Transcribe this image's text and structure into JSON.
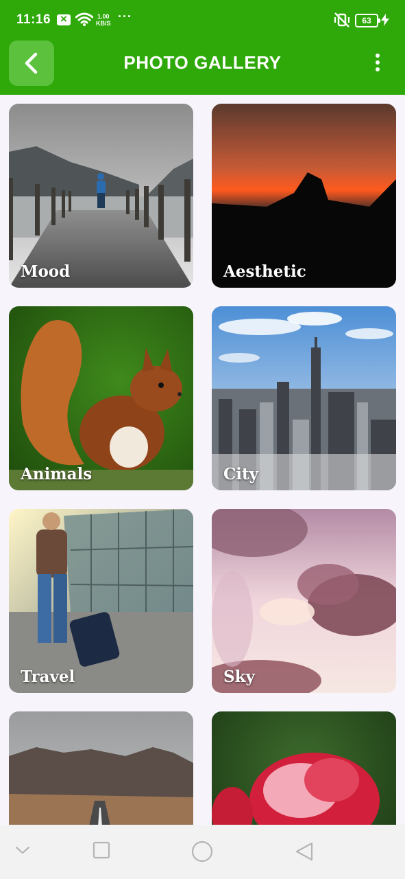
{
  "status_bar": {
    "time": "11:16",
    "speed_value": "1.00",
    "speed_unit": "KB/S",
    "more": "···",
    "battery": "63"
  },
  "app_bar": {
    "title": "PHOTO GALLERY",
    "back_icon": "chevron-left-icon",
    "menu_icon": "more-vert-icon"
  },
  "categories": [
    {
      "label": "Mood"
    },
    {
      "label": "Aesthetic"
    },
    {
      "label": "Animals"
    },
    {
      "label": "City"
    },
    {
      "label": "Travel"
    },
    {
      "label": "Sky"
    },
    {
      "label": ""
    },
    {
      "label": ""
    }
  ],
  "nav_bar": {
    "icons": [
      "chevron-down-icon",
      "recents-square-icon",
      "home-circle-icon",
      "back-triangle-icon"
    ]
  },
  "colors": {
    "primary": "#2fa90a",
    "back_button": "#5cc13d",
    "background": "#f7f4fb"
  }
}
